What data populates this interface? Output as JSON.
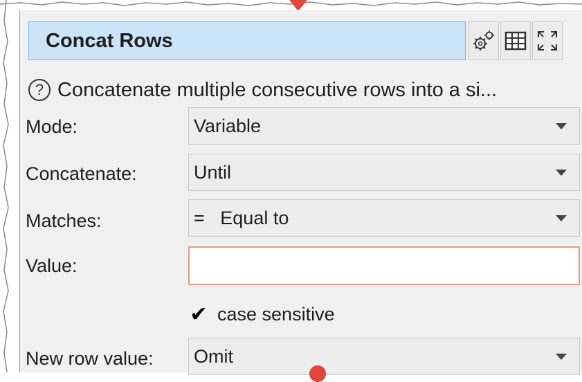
{
  "panel": {
    "title": "Concat Rows",
    "toolbar": {
      "options_icon": "gears-icon",
      "table_icon": "table-icon",
      "expand_icon": "expand-icon"
    },
    "help_text": "Concatenate multiple consecutive rows into a si...",
    "fields": {
      "mode": {
        "label": "Mode:",
        "value": "Variable"
      },
      "concatenate": {
        "label": "Concatenate:",
        "value": "Until"
      },
      "matches": {
        "label": "Matches:",
        "value": "=   Equal to"
      },
      "value": {
        "label": "Value:",
        "value": ""
      },
      "case_sensitive": {
        "label": "case sensitive",
        "checked": true
      },
      "new_row_value": {
        "label": "New row value:",
        "value": "Omit"
      }
    }
  },
  "colors": {
    "title_bg": "#cce4f7",
    "panel_bg": "#f0f0f0",
    "input_error_border": "#e99a86",
    "pointer": "#e2453c"
  }
}
